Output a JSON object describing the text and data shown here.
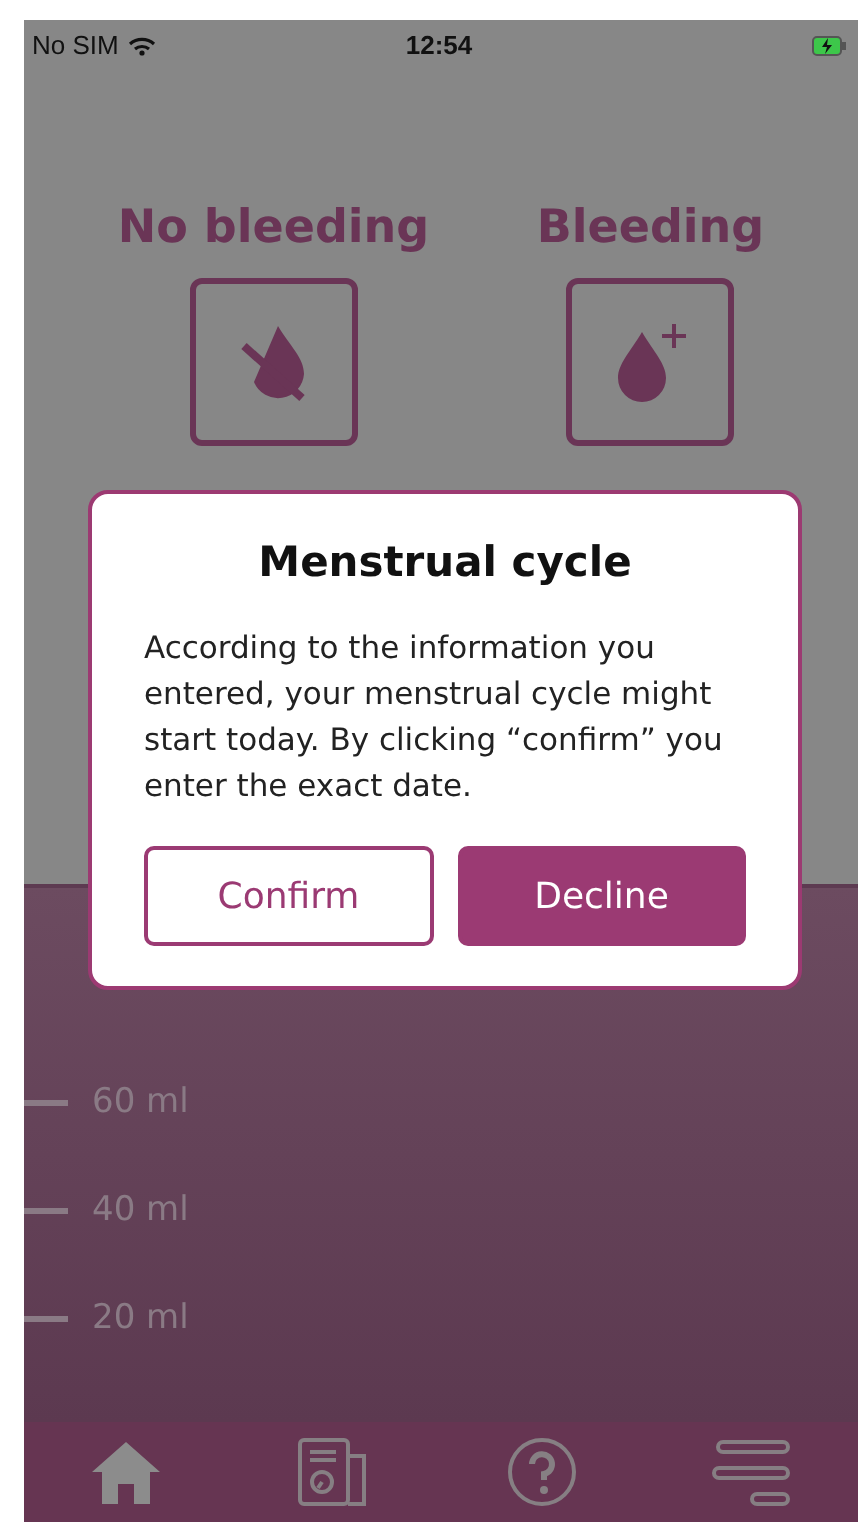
{
  "status_bar": {
    "carrier": "No SIM",
    "time": "12:54"
  },
  "bleeding_options": [
    {
      "label": "No bleeding",
      "kind": "none"
    },
    {
      "label": "Bleeding",
      "kind": "bleeding"
    }
  ],
  "volume_scale": [
    "60 ml",
    "40 ml",
    "20 ml"
  ],
  "tab_bar": [
    {
      "kind": "home",
      "selected": true
    },
    {
      "kind": "report",
      "selected": false
    },
    {
      "kind": "help",
      "selected": false
    },
    {
      "kind": "menu",
      "selected": false
    }
  ],
  "dialog": {
    "title": "Menstrual cycle",
    "message": "According to the information you entered, your menstrual cycle might start today. By clicking “confirm” you enter the exact date.",
    "buttons": [
      {
        "label": "Confirm",
        "kind": "outline"
      },
      {
        "label": "Decline",
        "kind": "filled"
      }
    ]
  }
}
